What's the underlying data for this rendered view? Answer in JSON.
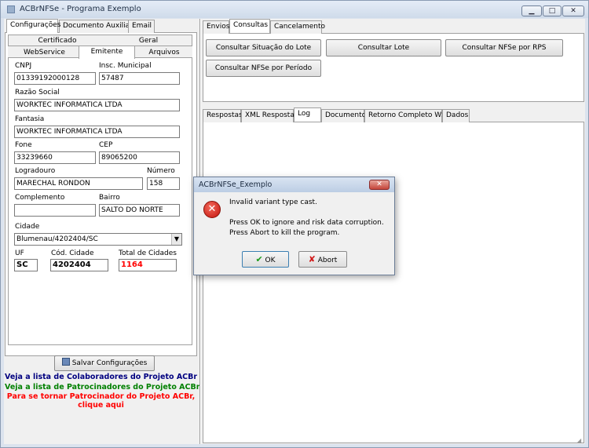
{
  "window": {
    "title": "ACBrNFSe - Programa Exemplo",
    "controls": {
      "minimize": "▁",
      "maximize": "□",
      "close": "✕"
    }
  },
  "left_tabs": [
    "Configurações",
    "Documento Auxiliar",
    "Email"
  ],
  "left_subtabs_row1": [
    "Certificado",
    "Geral"
  ],
  "left_subtabs_row2": [
    "WebService",
    "Emitente",
    "Arquivos"
  ],
  "emitente": {
    "cnpj_label": "CNPJ",
    "cnpj": "01339192000128",
    "insc_label": "Insc. Municipal",
    "insc": "57487",
    "razao_label": "Razão Social",
    "razao": "WORKTEC INFORMATICA LTDA",
    "fantasia_label": "Fantasia",
    "fantasia": "WORKTEC INFORMATICA LTDA",
    "fone_label": "Fone",
    "fone": "33239660",
    "cep_label": "CEP",
    "cep": "89065200",
    "logradouro_label": "Logradouro",
    "logradouro": "MARECHAL RONDON",
    "numero_label": "Número",
    "numero": "158",
    "complemento_label": "Complemento",
    "complemento": "",
    "bairro_label": "Bairro",
    "bairro": "SALTO DO NORTE",
    "cidade_label": "Cidade",
    "cidade": "Blumenau/4202404/SC",
    "uf_label": "UF",
    "uf": "SC",
    "cod_cidade_label": "Cód. Cidade",
    "cod_cidade": "4202404",
    "total_cidades_label": "Total de Cidades",
    "total_cidades": "1164"
  },
  "save_button": "Salvar Configurações",
  "links": {
    "colaboradores": "Veja a lista de Colaboradores do Projeto ACBr",
    "patrocinadores": "Veja a lista de Patrocinadores do Projeto ACBr",
    "tornar_line1": "Para se tornar Patrocinador do Projeto ACBr,",
    "tornar_line2": "clique aqui"
  },
  "right_tabs": [
    "Envios",
    "Consultas",
    "Cancelamento"
  ],
  "consultas_buttons": [
    "Consultar Situação do Lote",
    "Consultar Lote",
    "Consultar NFSe por RPS",
    "Consultar NFSe por Período"
  ],
  "result_tabs": [
    "Respostas",
    "XML Resposta",
    "Log",
    "Documento",
    "Retorno Completo WS",
    "Dados"
  ],
  "dialog": {
    "title": "ACBrNFSe_Exemplo",
    "message": "Invalid variant type cast.",
    "detail1": "Press OK to ignore and risk data corruption.",
    "detail2": "Press Abort to kill the program.",
    "ok": "OK",
    "abort": "Abort"
  },
  "colors": {
    "link_blue": "#000080",
    "link_green": "#008000",
    "link_red": "#ff0000",
    "total_red": "#ff0000"
  }
}
